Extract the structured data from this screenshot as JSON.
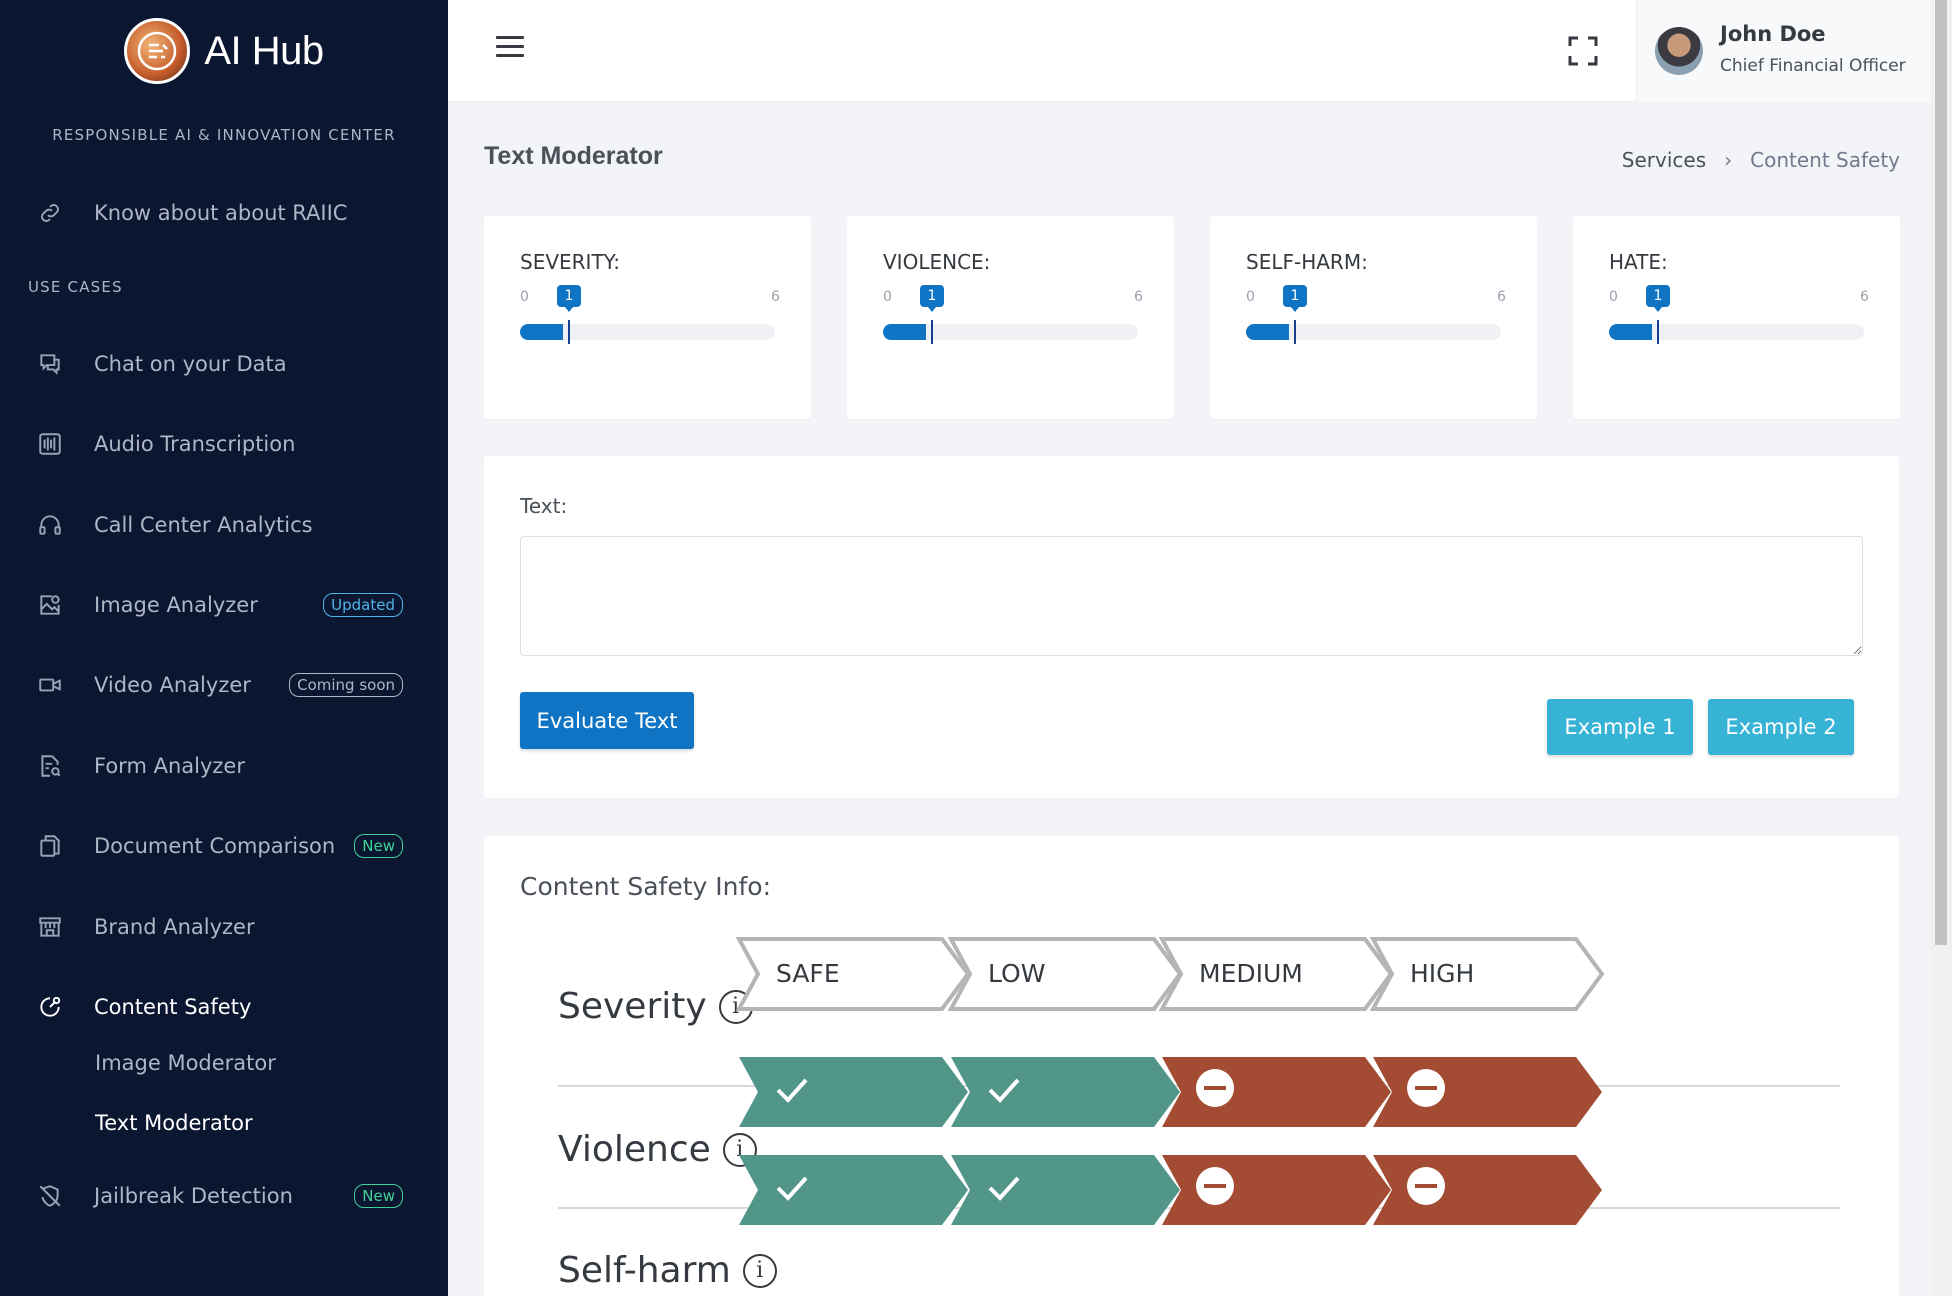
{
  "app": {
    "brand": "AI Hub",
    "org": "RESPONSIBLE AI & INNOVATION CENTER"
  },
  "sidebar": {
    "about": "Know about about RAIIC",
    "section": "USE CASES",
    "items": [
      {
        "label": "Chat on your Data",
        "icon": "chat-icon"
      },
      {
        "label": "Audio Transcription",
        "icon": "audio-icon"
      },
      {
        "label": "Call Center Analytics",
        "icon": "headset-icon"
      },
      {
        "label": "Image Analyzer",
        "icon": "image-icon",
        "badge": "Updated"
      },
      {
        "label": "Video Analyzer",
        "icon": "video-icon",
        "badge": "Coming soon"
      },
      {
        "label": "Form Analyzer",
        "icon": "form-icon"
      },
      {
        "label": "Document Comparison",
        "icon": "documents-icon",
        "badge": "New"
      },
      {
        "label": "Brand Analyzer",
        "icon": "store-icon"
      },
      {
        "label": "Content Safety",
        "icon": "shield-icon"
      },
      {
        "label": "Jailbreak Detection",
        "icon": "shield-off-icon",
        "badge": "New"
      }
    ],
    "sub_items": [
      "Image Moderator",
      "Text Moderator"
    ]
  },
  "user": {
    "name": "John Doe",
    "role": "Chief Financial Officer"
  },
  "page": {
    "title": "Text Moderator",
    "breadcrumb": [
      "Services",
      "Content Safety"
    ],
    "breadcrumb_sep": "›"
  },
  "sliders": [
    {
      "title": "SEVERITY:",
      "min": "0",
      "max": "6",
      "value": "1"
    },
    {
      "title": "VIOLENCE:",
      "min": "0",
      "max": "6",
      "value": "1"
    },
    {
      "title": "SELF-HARM:",
      "min": "0",
      "max": "6",
      "value": "1"
    },
    {
      "title": "HATE:",
      "min": "0",
      "max": "6",
      "value": "1"
    }
  ],
  "form": {
    "text_label": "Text:",
    "text_value": "",
    "evaluate_label": "Evaluate Text",
    "example1_label": "Example 1",
    "example2_label": "Example 2"
  },
  "info": {
    "title": "Content Safety Info:",
    "info_glyph": "i",
    "levels": [
      "SAFE",
      "LOW",
      "MEDIUM",
      "HIGH"
    ],
    "rows": [
      {
        "label": "Severity"
      },
      {
        "label": "Violence",
        "results": [
          "check",
          "check",
          "minus",
          "minus"
        ]
      },
      {
        "label": "Self-harm",
        "results": [
          "check",
          "check",
          "minus",
          "minus"
        ]
      }
    ]
  },
  "colors": {
    "sidebar": "#0b1630",
    "primary": "#0f74c4",
    "example": "#37b3d6",
    "safe": "#52968a",
    "blocked": "#a44c33"
  }
}
